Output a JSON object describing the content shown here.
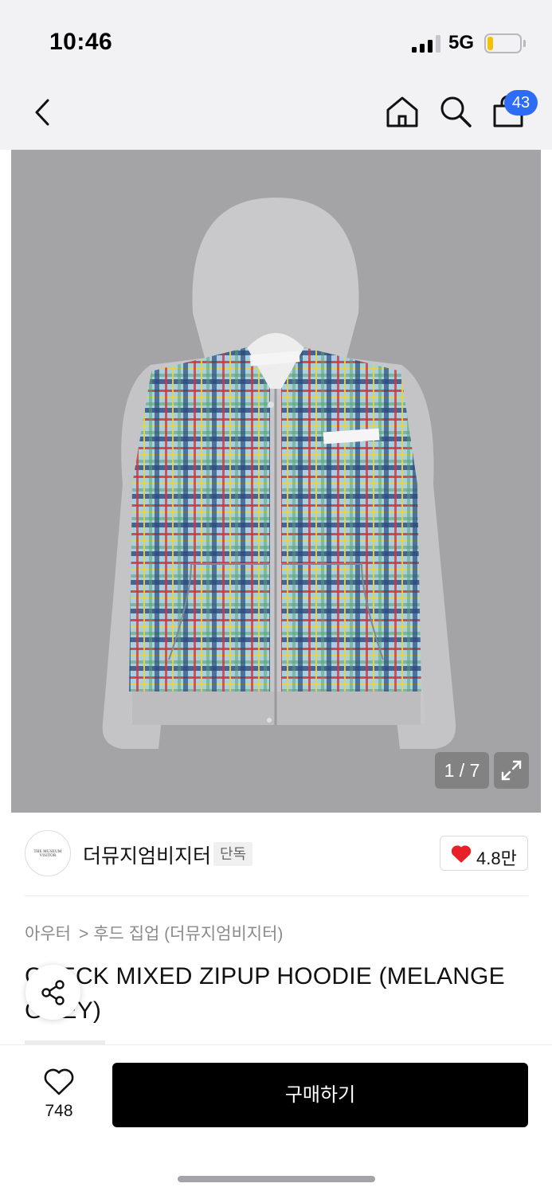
{
  "status_bar": {
    "time": "10:46",
    "network": "5G"
  },
  "nav": {
    "cart_count": "43"
  },
  "gallery": {
    "counter": "1 / 7"
  },
  "brand": {
    "logo_text": "THE MUSEUM VISITOR",
    "name": "더뮤지엄비지터",
    "badge": "단독",
    "likes": "4.8만"
  },
  "breadcrumb": {
    "category": "아우터",
    "separator": ">",
    "subcategory": "후드 집업 (더뮤지엄비지터)"
  },
  "product": {
    "title": "CHECK MIXED ZIPUP HOODIE (MELANGE GREY)"
  },
  "bottom_bar": {
    "wish_count": "748",
    "buy_label": "구매하기"
  },
  "colors": {
    "accent_badge": "#2d6df6",
    "heart": "#e8202a",
    "primary_button": "#000000"
  }
}
